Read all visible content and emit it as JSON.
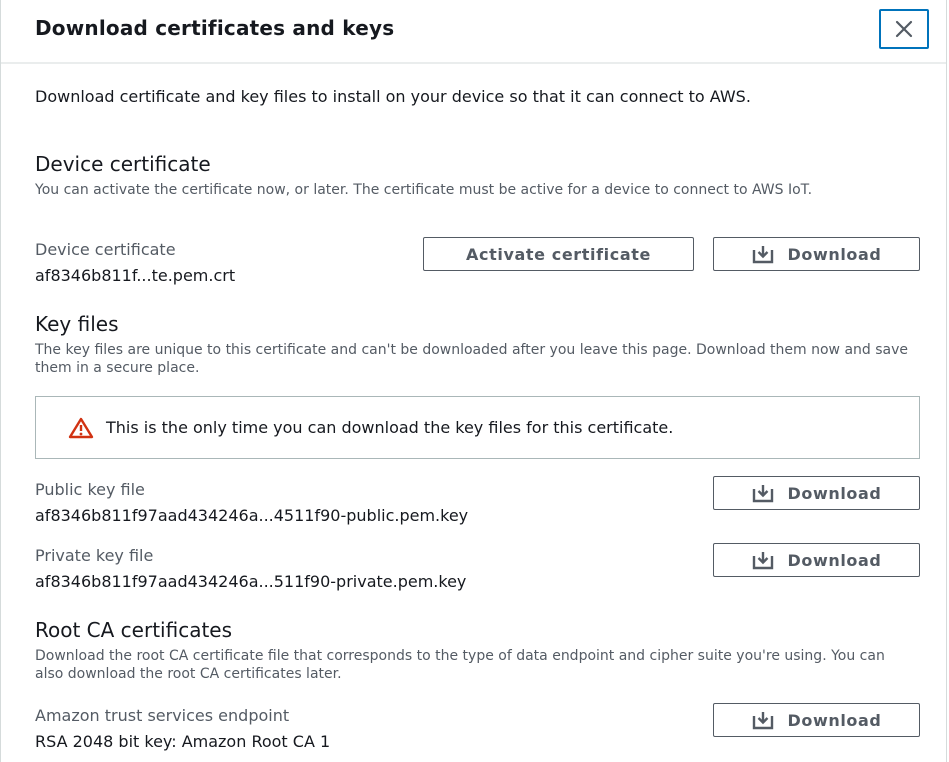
{
  "modal": {
    "title": "Download certificates and keys",
    "close_icon": "close-icon",
    "intro": "Download certificate and key files to install on your device so that it can connect to AWS."
  },
  "device_certificate": {
    "heading": "Device certificate",
    "description": "You can activate the certificate now, or later. The certificate must be active for a device to connect to AWS IoT.",
    "label": "Device certificate",
    "value": "af8346b811f...te.pem.crt",
    "activate_label": "Activate certificate",
    "download_label": "Download"
  },
  "key_files": {
    "heading": "Key files",
    "description": "The key files are unique to this certificate and can't be downloaded after you leave this page. Download them now and save them in a secure place.",
    "alert_icon": "warning-icon",
    "alert_color": "#d13212",
    "alert_text": "This is the only time you can download the key files for this certificate.",
    "public_label": "Public key file",
    "public_value": "af8346b811f97aad434246a...4511f90-public.pem.key",
    "public_download": "Download",
    "private_label": "Private key file",
    "private_value": "af8346b811f97aad434246a...511f90-private.pem.key",
    "private_download": "Download"
  },
  "root_ca": {
    "heading": "Root CA certificates",
    "description": "Download the root CA certificate file that corresponds to the type of data endpoint and cipher suite you're using. You can also download the root CA certificates later.",
    "endpoint_label": "Amazon trust services endpoint",
    "endpoint_value": "RSA 2048 bit key: Amazon Root CA 1",
    "download_label": "Download"
  },
  "icons": {
    "download": "download-icon"
  },
  "colors": {
    "close_border": "#0073bb",
    "button_border": "#545b64"
  }
}
